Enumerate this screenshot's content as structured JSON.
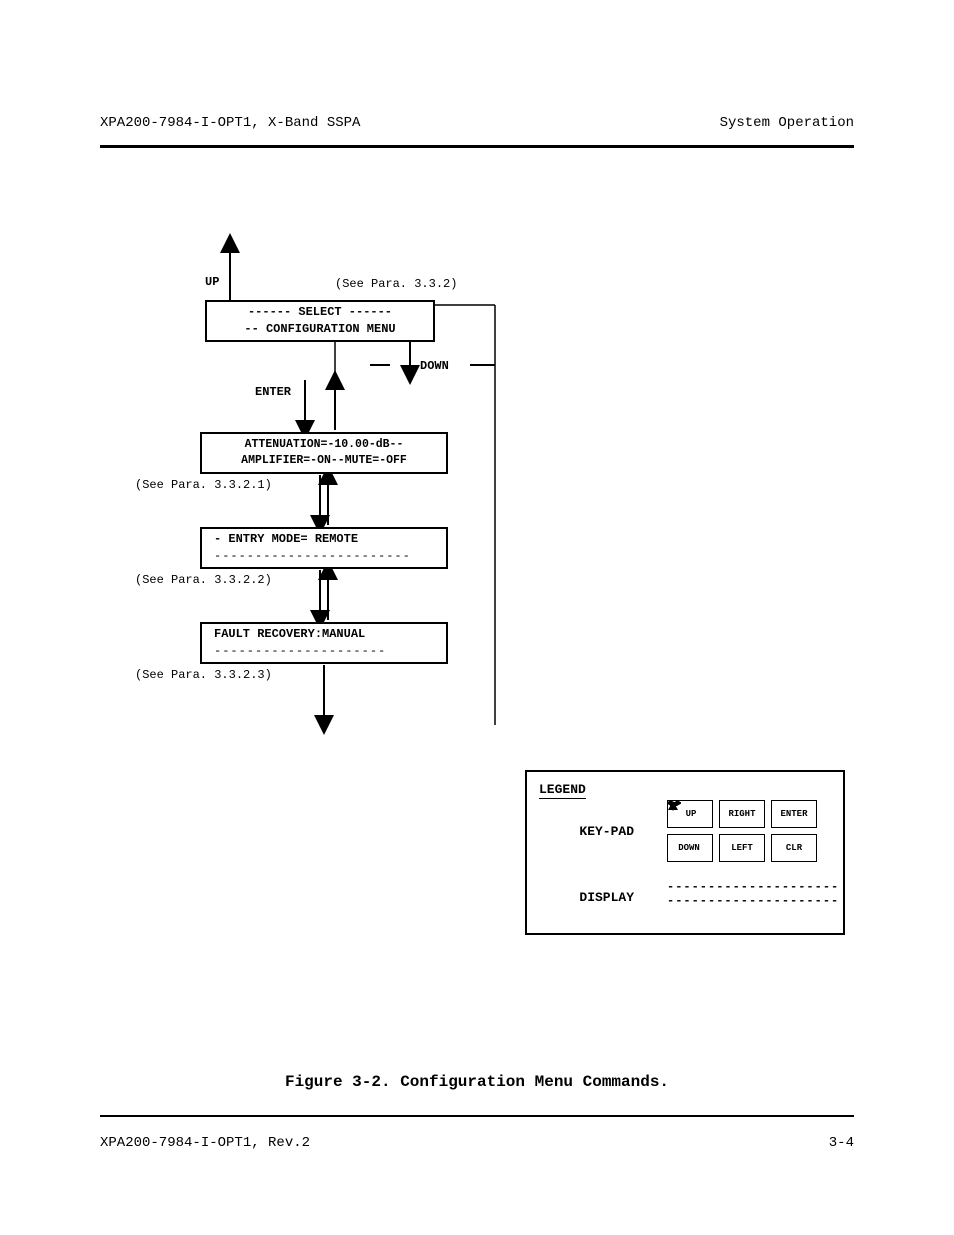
{
  "header": {
    "left": "XPA200-7984-I-OPT1, X-Band SSPA",
    "right": "System Operation"
  },
  "footer": {
    "left": "XPA200-7984-I-OPT1, Rev.2",
    "right": "3-4"
  },
  "caption": "Figure 3-2.  Configuration Menu Commands.",
  "labels": {
    "up": "UP",
    "see332": "(See Para. 3.3.2)",
    "down": "DOWN",
    "enter": "ENTER",
    "see3321": "(See Para. 3.3.2.1)",
    "see3322": "(See Para. 3.3.2.2)",
    "see3323": "(See Para. 3.3.2.3)"
  },
  "boxes": {
    "select": {
      "l1": "------ SELECT ------",
      "l2": "-- CONFIGURATION MENU"
    },
    "atten": {
      "l1": "ATTENUATION=-10.00-dB--",
      "l2": "AMPLIFIER=-ON--MUTE=-OFF"
    },
    "entry": {
      "l1": "- ENTRY MODE= REMOTE",
      "l2": "------------------------"
    },
    "fault": {
      "l1": "FAULT RECOVERY:MANUAL",
      "l2": "---------------------"
    }
  },
  "legend": {
    "title": "LEGEND",
    "keypad": "KEY-PAD",
    "display": "DISPLAY",
    "keys": {
      "up": "UP",
      "right": "RIGHT",
      "enter": "ENTER",
      "down": "DOWN",
      "left": "LEFT",
      "clr": "CLR"
    },
    "displayLine": "---------------------"
  }
}
